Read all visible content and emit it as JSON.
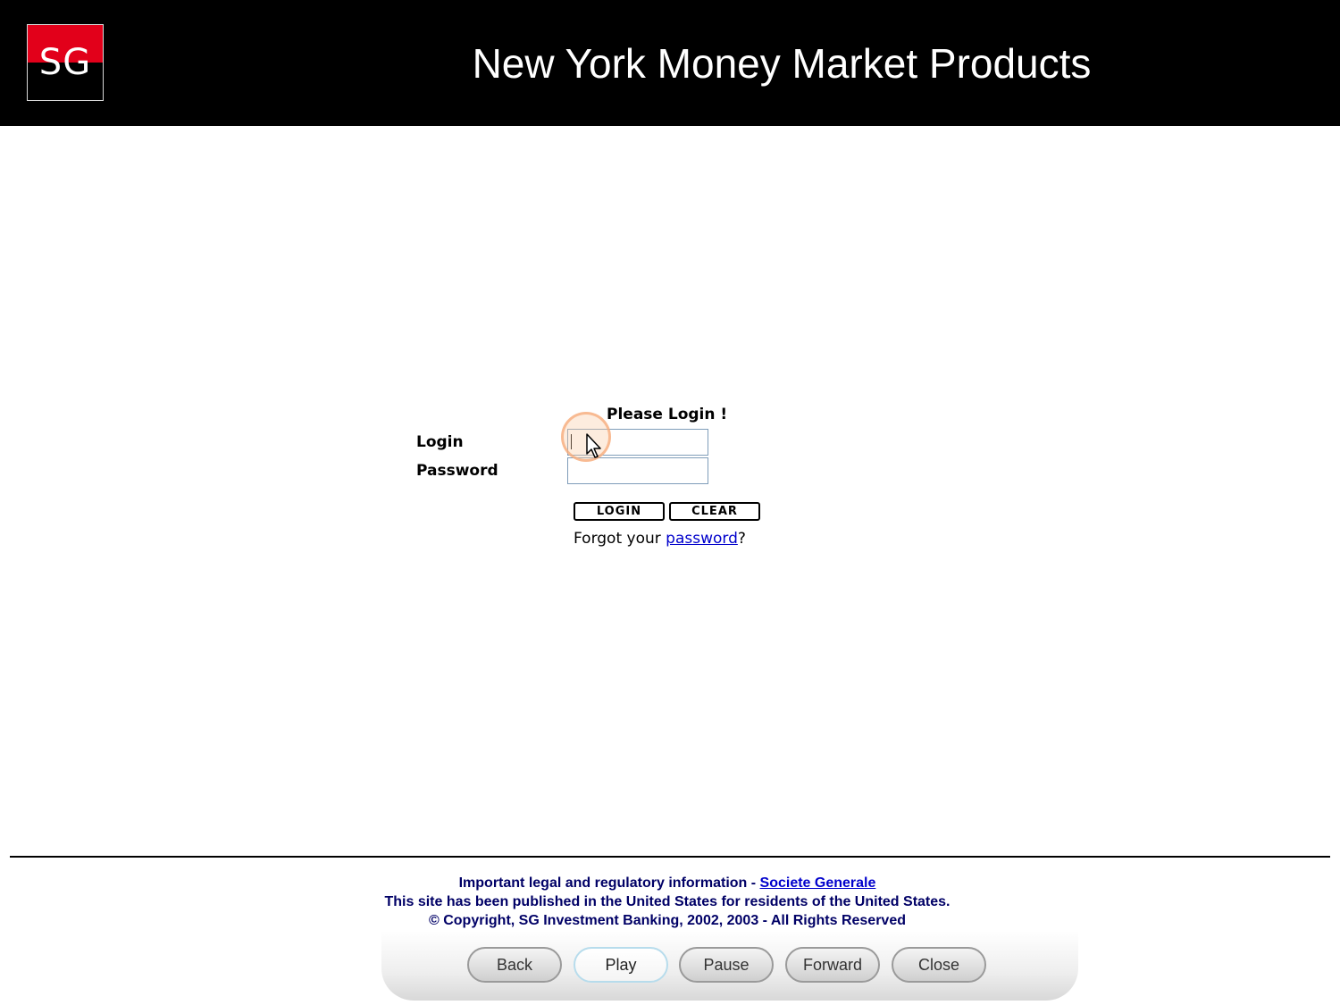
{
  "header": {
    "logo_text": "SG",
    "title": "New York Money Market Products"
  },
  "login_form": {
    "heading": "Please Login !",
    "login_label": "Login",
    "password_label": "Password",
    "login_value": "",
    "password_value": "",
    "login_button": "LOGIN",
    "clear_button": "CLEAR",
    "forgot_prefix": "Forgot your ",
    "forgot_link": "password",
    "forgot_suffix": "?"
  },
  "footer": {
    "legal_prefix": "Important legal and regulatory information - ",
    "legal_link": "Societe Generale",
    "publication_note": "This site has been published in the United States for residents of the United States.",
    "copyright": "© Copyright, SG Investment Banking, 2002, 2003 - All Rights Reserved"
  },
  "player": {
    "buttons": [
      "Back",
      "Play",
      "Pause",
      "Forward",
      "Close"
    ],
    "active": "Play"
  },
  "colors": {
    "brand_red": "#e2001a",
    "header_bg": "#000000",
    "link": "#0000cc",
    "footer_text": "#000066"
  }
}
